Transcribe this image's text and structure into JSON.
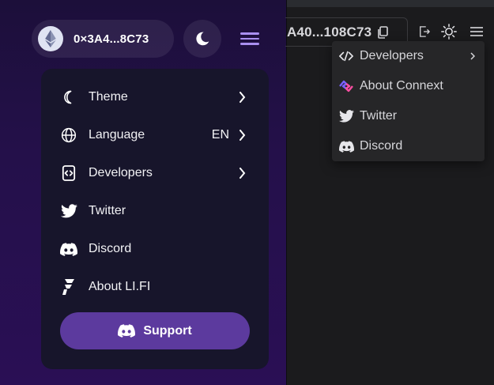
{
  "wallet": {
    "address": "0×3A4...8C73"
  },
  "menu": {
    "items": [
      {
        "label": "Theme",
        "value": ""
      },
      {
        "label": "Language",
        "value": "EN"
      },
      {
        "label": "Developers",
        "value": ""
      },
      {
        "label": "Twitter",
        "value": ""
      },
      {
        "label": "Discord",
        "value": ""
      },
      {
        "label": "About LI.FI",
        "value": ""
      }
    ],
    "support_label": "Support"
  },
  "right": {
    "address": "A40...108C73",
    "dropdown": [
      {
        "label": "Developers",
        "icon": "code-icon"
      },
      {
        "label": "About Connext",
        "icon": "connext-logo-icon"
      },
      {
        "label": "Twitter",
        "icon": "twitter-icon"
      },
      {
        "label": "Discord",
        "icon": "discord-icon"
      }
    ]
  },
  "colors": {
    "accent_purple": "#5c3a9e",
    "hamburger": "#a98ff0",
    "card_bg": "#17152b",
    "dropdown_bg": "#262628"
  }
}
